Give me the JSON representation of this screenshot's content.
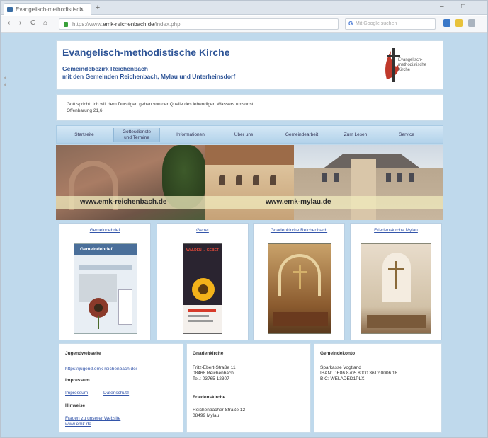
{
  "browser": {
    "tab_title": "Evangelisch-methodistisch",
    "tab_close": "×",
    "new_tab": "+",
    "url_prefix": "https://www.",
    "url_domain": "emk-reichenbach.de",
    "url_suffix": "/index.php",
    "search_placeholder": "Mit Google suchen",
    "controls": {
      "minimize": "–",
      "maximize": "□",
      "back": "‹",
      "forward": "›",
      "reload": "C",
      "home": "⌂"
    }
  },
  "header": {
    "title": "Evangelisch-methodistische Kirche",
    "subtitle_line1": "Gemeindebezirk Reichenbach",
    "subtitle_line2": "mit den Gemeinden Reichenbach, Mylau und Unterheinsdorf",
    "logo_line1": "Evangelisch-",
    "logo_line2": "methodistische",
    "logo_line3": "Kirche"
  },
  "verse": {
    "line1": "Gott spricht: Ich will dem Durstigen geben von der Quelle des lebendigen Wassers umsonst.",
    "line2": "Offenbarung 21,6"
  },
  "menu": {
    "items": [
      {
        "label": "Startseite"
      },
      {
        "label": "Gottesdienste und Termine",
        "line1": "Gottesdienste",
        "line2": "und Termine"
      },
      {
        "label": "Informationen"
      },
      {
        "label": "Über uns"
      },
      {
        "label": "Gemeindearbeit"
      },
      {
        "label": "Zum Lesen"
      },
      {
        "label": "Service"
      }
    ]
  },
  "banner": {
    "url_left": "www.emk-reichenbach.de",
    "url_right": "www.emk-mylau.de"
  },
  "cards": [
    {
      "title": "Gemeindebrief",
      "thumb_text": "Gemeindebrief"
    },
    {
      "title": "Gebet",
      "thumb_text": "WALDEN ... GEBET ..."
    },
    {
      "title": "Gnadenkirche Reichenbach"
    },
    {
      "title": "Friedenskirche Mylau"
    }
  ],
  "info": {
    "col1": {
      "heading1": "Jugendwebseite",
      "link1": "https://jugend.emk-reichenbach.de/",
      "heading2": "Impressum",
      "link2a": "Impressum",
      "link2b": "Datenschutz",
      "heading3": "Hinweise",
      "link3a": "Fragen zu unserer Website",
      "link3b": "www.emk.de"
    },
    "col2": {
      "heading1": "Gnadenkirche",
      "addr1_line1": "Fritz-Ebert-Straße 11",
      "addr1_line2": "08468 Reichenbach",
      "addr1_line3": "Tel.: 03765 12307",
      "heading2": "Friedenskirche",
      "addr2_line1": "Reichenbacher Straße 12",
      "addr2_line2": "08499 Mylau"
    },
    "col3": {
      "heading1": "Gemeindekonto",
      "line1": "Sparkasse Vogtland",
      "line2": "IBAN: DE86 8705 8000 3612 0006 18",
      "line3": "BIC: WELADED1PLX"
    }
  },
  "colors": {
    "accent": "#2f5597",
    "page_bg": "#bfd9ec",
    "menu_bg": "#c4dcef",
    "link": "#3355aa"
  }
}
